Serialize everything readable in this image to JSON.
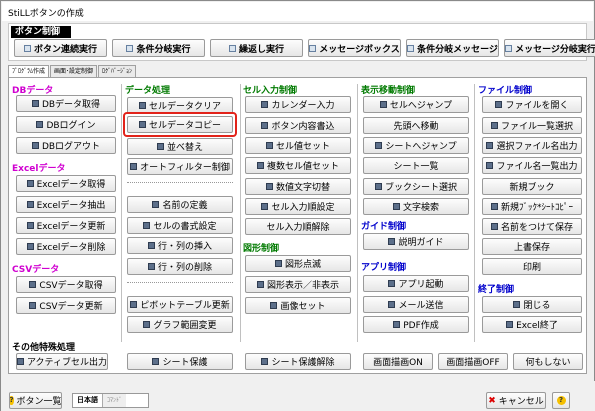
{
  "window": {
    "title": "StiLLボタンの作成"
  },
  "top_group": {
    "title": "ボタン制御",
    "buttons": [
      "ボタン連続実行",
      "条件分岐実行",
      "繰返し実行",
      "メッセージボックス",
      "条件分岐メッセージ",
      "メッセージ分岐実行"
    ]
  },
  "tabs": [
    "ﾌﾟﾛｸﾞﾗﾑ作成",
    "画面･設定制御",
    "ﾛｸﾞﾊﾞｰｼﾞｮﾝ"
  ],
  "sections": {
    "db": {
      "title": "DBデータ",
      "buttons": [
        "DBデータ取得",
        "DBログイン",
        "DBログアウト"
      ]
    },
    "excel": {
      "title": "Excelデータ",
      "buttons": [
        "Excelデータ取得",
        "Excelデータ抽出",
        "Excelデータ更新",
        "Excelデータ削除"
      ]
    },
    "csv": {
      "title": "CSVデータ",
      "buttons": [
        "CSVデータ取得",
        "CSVデータ更新"
      ]
    },
    "data": {
      "title": "データ処理",
      "buttons": [
        "セルデータクリア",
        "セルデータコピー",
        "並べ替え",
        "オートフィルター制御",
        "名前の定義",
        "セルの書式設定",
        "行・列の挿入",
        "行・列の削除",
        "ピボットテーブル更新",
        "グラフ範囲変更"
      ]
    },
    "cell": {
      "title": "セル入力制御",
      "buttons": [
        "カレンダー入力",
        "ボタン内容書込",
        "セル値セット",
        "複数セル値セット",
        "数値文字切替",
        "セル入力順設定",
        "セル入力順解除"
      ]
    },
    "shape": {
      "title": "図形制御",
      "buttons": [
        "図形点滅",
        "図形表示／非表示",
        "画像セット"
      ]
    },
    "move": {
      "title": "表示移動制御",
      "buttons": [
        "セルへジャンプ",
        "先頭へ移動",
        "シートへジャンプ",
        "シート一覧",
        "ブックシート選択",
        "文字検索"
      ]
    },
    "guide": {
      "title": "ガイド制御",
      "buttons": [
        "説明ガイド"
      ]
    },
    "app": {
      "title": "アプリ制御",
      "buttons": [
        "アプリ起動",
        "メール送信",
        "PDF作成"
      ]
    },
    "file": {
      "title": "ファイル制御",
      "buttons": [
        "ファイルを開く",
        "ファイル一覧選択",
        "選択ファイル名出力",
        "ファイル名一覧出力",
        "新規ブック",
        "新規ﾌﾞｯｸ*ｼｰﾄｺﾋﾟｰ",
        "名前をつけて保存",
        "上書保存",
        "印刷"
      ]
    },
    "end": {
      "title": "終了制御",
      "buttons": [
        "閉じる",
        "Excel終了"
      ]
    },
    "other": {
      "title": "その他特殊処理",
      "buttons": [
        "アクティブセル出力",
        "シート保護",
        "シート保護解除",
        "画面描画ON",
        "画面描画OFF",
        "何もしない"
      ]
    }
  },
  "bottom": {
    "list_button": "ボタン一覧",
    "lang_on": "日本語",
    "lang_off": "ｺﾏﾝﾄﾞ",
    "cancel_button": "キャンセル",
    "help": "?"
  }
}
